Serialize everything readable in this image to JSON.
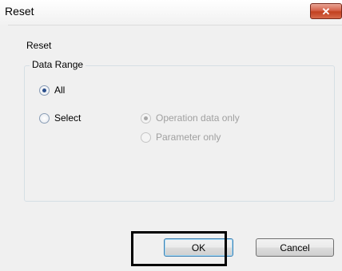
{
  "window": {
    "title": "Reset",
    "close_glyph": "x"
  },
  "content": {
    "label": "Reset"
  },
  "data_range": {
    "legend": "Data Range",
    "options": [
      {
        "label": "All",
        "checked": true,
        "enabled": true
      },
      {
        "label": "Select",
        "checked": false,
        "enabled": true
      }
    ],
    "sub_options": [
      {
        "label": "Operation data only",
        "checked": true,
        "enabled": false
      },
      {
        "label": "Parameter only",
        "checked": false,
        "enabled": false
      }
    ]
  },
  "buttons": {
    "ok_label": "OK",
    "cancel_label": "Cancel"
  },
  "colors": {
    "close_button": "#c2401f",
    "highlight": "#000000",
    "radio_selected": "#2a4f8c"
  }
}
